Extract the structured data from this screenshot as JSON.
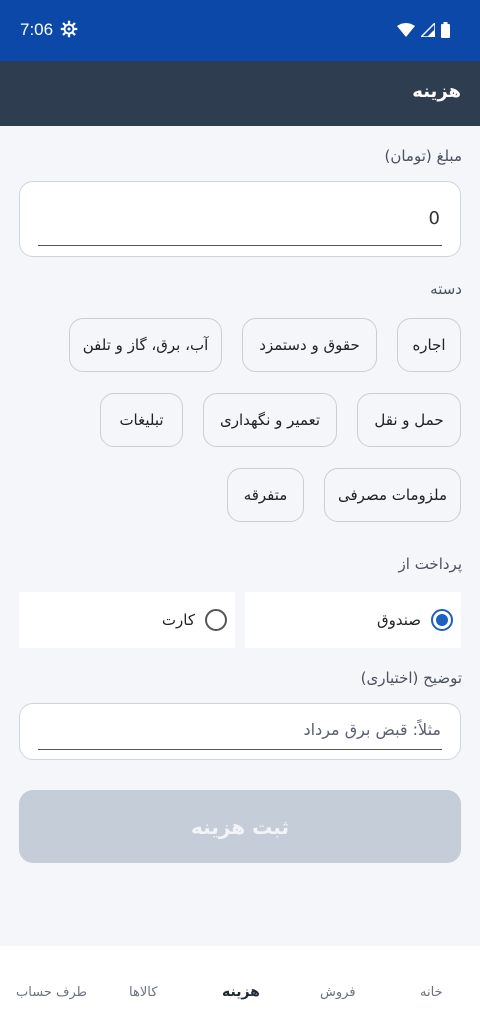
{
  "status_bar": {
    "time": "7:06"
  },
  "app_bar": {
    "title": "هزینه"
  },
  "amount": {
    "label": "مبلغ (تومان)",
    "value": "0"
  },
  "category": {
    "label": "دسته",
    "chips": [
      "اجاره",
      "حقوق و دستمزد",
      "آب، برق، گاز و تلفن",
      "حمل و نقل",
      "تعمیر و نگهداری",
      "تبلیغات",
      "ملزومات مصرفی",
      "متفرقه"
    ]
  },
  "payment": {
    "label": "پرداخت از",
    "options": [
      {
        "label": "صندوق",
        "selected": true
      },
      {
        "label": "کارت",
        "selected": false
      }
    ]
  },
  "description": {
    "label": "توضیح (اختیاری)",
    "placeholder": "مثلاً: قبض برق مرداد"
  },
  "submit_label": "ثبت هزینه",
  "bottom_nav": {
    "items": [
      "خانه",
      "فروش",
      "هزینه",
      "کالاها",
      "طرف حساب"
    ],
    "active": "هزینه"
  },
  "colors": {
    "status_bar": "#0b48a8",
    "app_bar": "#2e3e50",
    "accent": "#1f5fbf",
    "submit_disabled": "#c5cdd9"
  }
}
